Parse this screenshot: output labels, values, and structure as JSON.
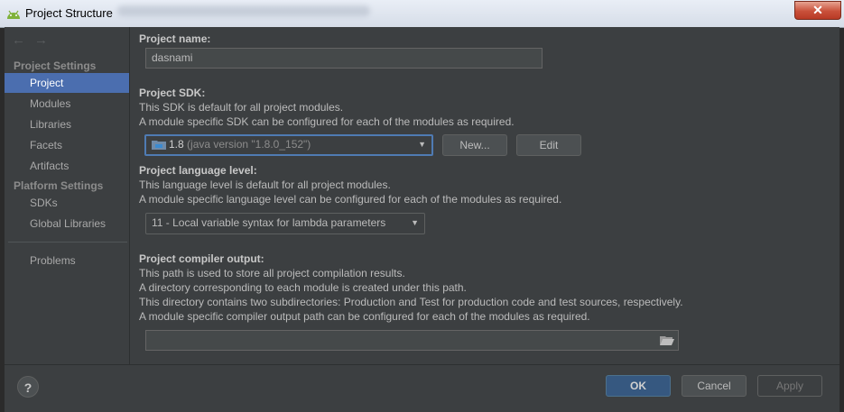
{
  "window": {
    "title": "Project Structure",
    "close_label": "✕"
  },
  "nav": {
    "back_icon": "←",
    "forward_icon": "→",
    "project_settings_header": "Project Settings",
    "project_settings_items": [
      "Project",
      "Modules",
      "Libraries",
      "Facets",
      "Artifacts"
    ],
    "platform_settings_header": "Platform Settings",
    "platform_settings_items": [
      "SDKs",
      "Global Libraries"
    ],
    "problems": "Problems",
    "selected": "Project"
  },
  "project_name": {
    "label": "Project name:",
    "value": "dasnami"
  },
  "project_sdk": {
    "label": "Project SDK:",
    "desc1": "This SDK is default for all project modules.",
    "desc2": "A module specific SDK can be configured for each of the modules as required.",
    "selected_version": "1.8",
    "selected_detail": "(java version \"1.8.0_152\")",
    "new_button": "New...",
    "edit_button": "Edit"
  },
  "language_level": {
    "label": "Project language level:",
    "desc1": "This language level is default for all project modules.",
    "desc2": "A module specific language level can be configured for each of the modules as required.",
    "selected": "11 - Local variable syntax for lambda parameters"
  },
  "compiler_output": {
    "label": "Project compiler output:",
    "desc1": "This path is used to store all project compilation results.",
    "desc2": "A directory corresponding to each module is created under this path.",
    "desc3": "This directory contains two subdirectories: Production and Test for production code and test sources, respectively.",
    "desc4": "A module specific compiler output path can be configured for each of the modules as required.",
    "value": ""
  },
  "footer": {
    "help": "?",
    "ok": "OK",
    "cancel": "Cancel",
    "apply": "Apply"
  },
  "colors": {
    "selection": "#4b6eaf",
    "panel": "#3c3f41",
    "ok_button": "#365880"
  }
}
